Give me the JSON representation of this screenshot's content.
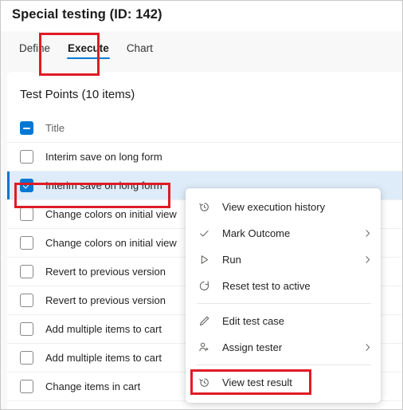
{
  "header": {
    "title": "Special testing (ID: 142)"
  },
  "tabs": [
    {
      "label": "Define",
      "selected": false
    },
    {
      "label": "Execute",
      "selected": true
    },
    {
      "label": "Chart",
      "selected": false
    }
  ],
  "main": {
    "card_title": "Test Points (10 items)",
    "grid_header": {
      "select_all_state": "indeterminate",
      "column_title": "Title"
    },
    "rows": [
      {
        "label": "Interim save on long form",
        "checked": false,
        "selected": false
      },
      {
        "label": "Interim save on long form",
        "checked": true,
        "selected": true
      },
      {
        "label": "Change colors on initial view",
        "checked": false,
        "selected": false
      },
      {
        "label": "Change colors on initial view",
        "checked": false,
        "selected": false
      },
      {
        "label": "Revert to previous version",
        "checked": false,
        "selected": false
      },
      {
        "label": "Revert to previous version",
        "checked": false,
        "selected": false
      },
      {
        "label": "Add multiple items to cart",
        "checked": false,
        "selected": false
      },
      {
        "label": "Add multiple items to cart",
        "checked": false,
        "selected": false
      },
      {
        "label": "Change items in cart",
        "checked": false,
        "selected": false
      }
    ]
  },
  "context_menu": {
    "items": [
      {
        "label": "View execution history",
        "icon": "history-icon",
        "submenu": false
      },
      {
        "label": "Mark Outcome",
        "icon": "checkmark-icon",
        "submenu": true
      },
      {
        "label": "Run",
        "icon": "play-icon",
        "submenu": true
      },
      {
        "label": "Reset test to active",
        "icon": "refresh-icon",
        "submenu": false
      },
      {
        "label": "Edit test case",
        "icon": "pencil-icon",
        "submenu": false
      },
      {
        "label": "Assign tester",
        "icon": "person-add-icon",
        "submenu": true
      },
      {
        "label": "View test result",
        "icon": "history-icon",
        "submenu": false
      }
    ]
  },
  "annotations": {
    "accent_color": "#0078d4",
    "highlight_color": "#e01b24",
    "selected_row_bg": "#deecf9",
    "boxes": [
      {
        "target": "tab-execute"
      },
      {
        "target": "selected-test-point-row"
      },
      {
        "target": "menu-item-view-test-result"
      }
    ]
  }
}
